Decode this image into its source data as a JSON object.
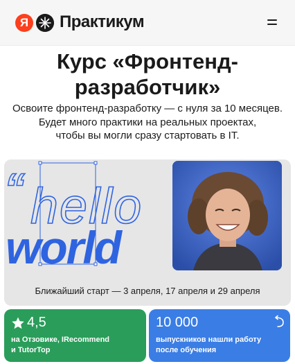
{
  "header": {
    "logo_letter": "Я",
    "brand": "Практикум"
  },
  "course": {
    "title_line1": "Курс «Фронтенд-",
    "title_line2": "разработчик»",
    "subtitle_line1": "Освоите фронтенд-разработку — с нуля за 10 месяцев.",
    "subtitle_line2": "Будет много практики на реальных проектах,",
    "subtitle_line3": "чтобы вы могли сразу стартовать в IT."
  },
  "hero": {
    "artwork_text_1": "hello",
    "artwork_text_2": "world",
    "next_start": "Ближайший старт — 3 апреля, 17 апреля и 29 апреля"
  },
  "stats": {
    "rating_value": "4,5",
    "rating_caption_line1": "на Отзовике, IRecommend",
    "rating_caption_line2": "и TutorTop",
    "graduates_value": "10 000",
    "graduates_caption_line1": "выпускников нашли работу",
    "graduates_caption_line2": "после обучения"
  },
  "colors": {
    "brand_red": "#fc3f1d",
    "green_card": "#2a9d5a",
    "blue_card": "#3a7de5",
    "art_blue": "#2f64e0"
  }
}
